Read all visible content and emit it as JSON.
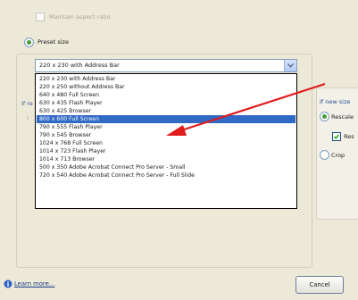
{
  "dialog": {
    "maintain_aspect_label": "Maintain aspect ratio",
    "preset_size_label": "Preset size",
    "combo_value": "220 x 230 with Address Bar",
    "left_fragment_1": "If re",
    "left_fragment_2": "I",
    "right_panel": {
      "title": "If new size",
      "rescale_label": "Rescale",
      "checkbox_label": "Res",
      "crop_label": "Crop"
    },
    "preset_options": [
      "220 x 230 with Address Bar",
      "220 x 250 without Address Bar",
      "640 x 480 Full Screen",
      "630 x 435 Flash Player",
      "630 x 425 Browser",
      "800 x 600 Full Screen",
      "790 x 555 Flash Player",
      "790 x 545 Browser",
      "1024 x 768 Full Screen",
      "1014 x 723 Flash Player",
      "1014 x 713 Browser",
      "500 x 350 Adobe Acrobat Connect Pro Server - Small",
      "720 x 540 Adobe Acrobat Connect Pro Server - Full Slide"
    ],
    "selected_index": 5,
    "learn_more_label": "Learn more...",
    "cancel_label": "Cancel"
  },
  "colors": {
    "selection": "#316ac5",
    "arrow": "#e01b1b"
  }
}
